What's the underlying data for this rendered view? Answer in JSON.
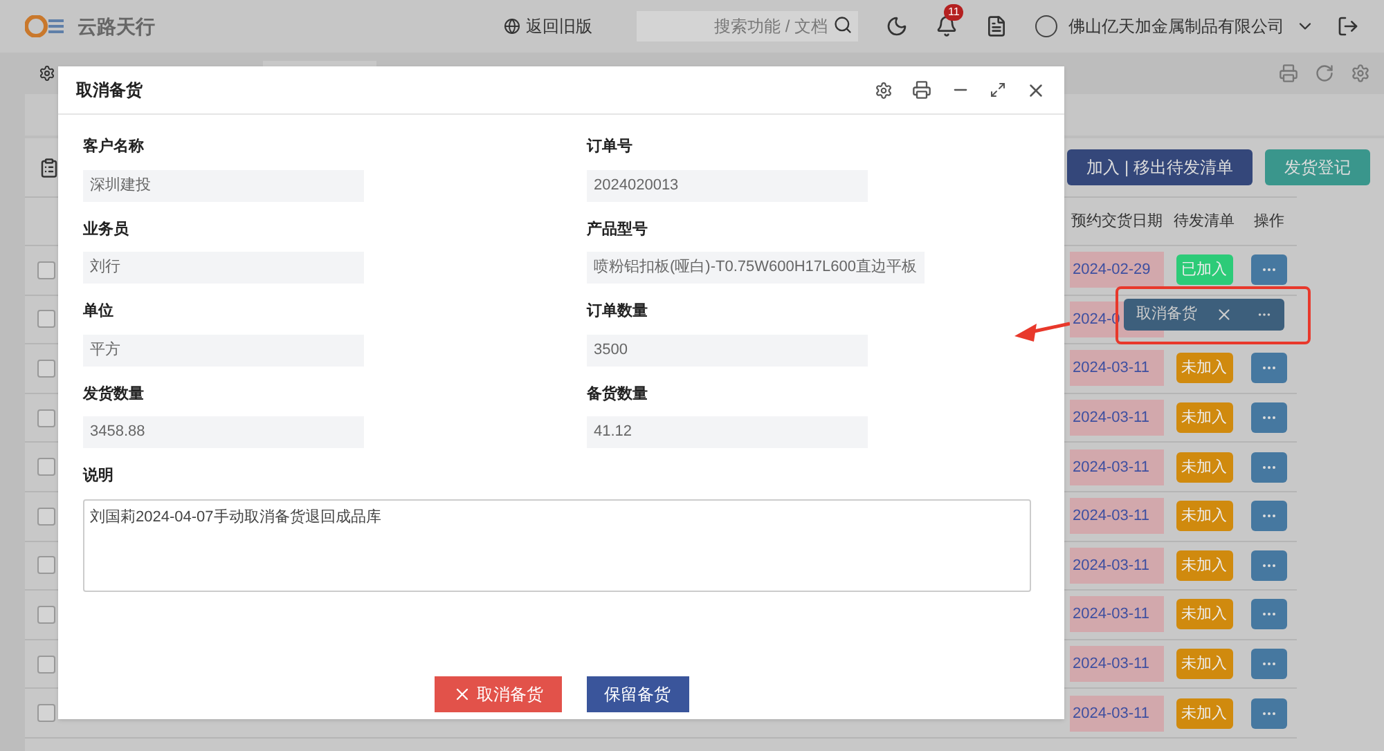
{
  "header": {
    "logo_text": "云路天行",
    "old_version_link": "返回旧版",
    "search": {
      "placeholder": "搜索功能 / 文档"
    },
    "notification_count": "11",
    "company": "佛山亿天加金属制品有限公司"
  },
  "toolbar": {
    "buttons": [
      {
        "label": "加入 | 移出待发清单",
        "kind": "navy"
      },
      {
        "label": "发货登记",
        "kind": "teal"
      }
    ]
  },
  "table": {
    "columns": [
      "预约交货日期",
      "待发清单",
      "操作"
    ],
    "rows": [
      {
        "kind": "normal",
        "checked": false,
        "date": "2024-02-29",
        "status": "已加入",
        "added": true
      },
      {
        "kind": "covered",
        "checked": false,
        "date": "2024-0"
      },
      {
        "kind": "normal",
        "checked": false,
        "date": "2024-03-11",
        "status": "未加入",
        "added": false
      },
      {
        "kind": "normal",
        "checked": false,
        "date": "2024-03-11",
        "status": "未加入",
        "added": false
      },
      {
        "kind": "normal",
        "checked": false,
        "date": "2024-03-11",
        "status": "未加入",
        "added": false
      },
      {
        "kind": "normal",
        "checked": false,
        "date": "2024-03-11",
        "status": "未加入",
        "added": false
      },
      {
        "kind": "normal",
        "checked": false,
        "date": "2024-03-11",
        "status": "未加入",
        "added": false
      },
      {
        "kind": "normal",
        "checked": false,
        "date": "2024-03-11",
        "status": "未加入",
        "added": false
      },
      {
        "kind": "normal",
        "checked": false,
        "date": "2024-03-11",
        "status": "未加入",
        "added": false
      },
      {
        "kind": "normal",
        "checked": false,
        "date": "2024-03-11",
        "status": "未加入",
        "added": false
      }
    ]
  },
  "popup": {
    "label": "取消备货"
  },
  "dialog": {
    "title": "取消备货",
    "fields": [
      {
        "label": "客户名称",
        "value": "深圳建投"
      },
      {
        "label": "订单号",
        "value": "2024020013"
      },
      {
        "label": "业务员",
        "value": "刘行"
      },
      {
        "label": "产品型号",
        "value": "喷粉铝扣板(哑白)-T0.75W600H17L600直边平板"
      },
      {
        "label": "单位",
        "value": "平方"
      },
      {
        "label": "订单数量",
        "value": "3500"
      },
      {
        "label": "发货数量",
        "value": "3458.88"
      },
      {
        "label": "备货数量",
        "value": "41.12"
      }
    ],
    "note": {
      "label": "说明",
      "value": "刘国莉2024-04-07手动取消备货退回成品库"
    },
    "buttons": [
      {
        "label": "取消备货",
        "kind": "danger"
      },
      {
        "label": "保留备货",
        "kind": "primary"
      }
    ]
  }
}
